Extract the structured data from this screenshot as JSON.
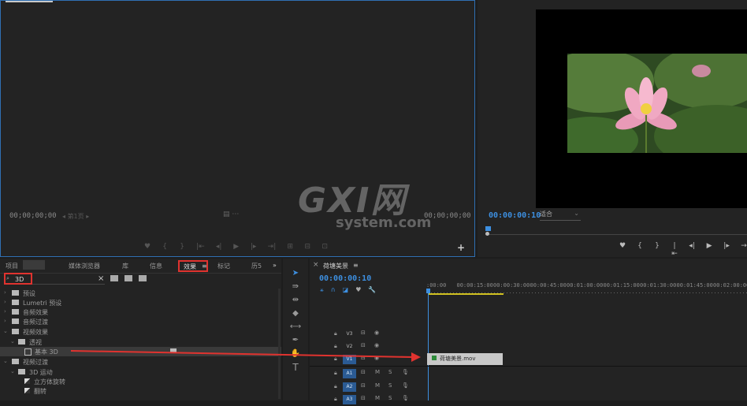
{
  "source_monitor": {
    "timecode_left": "00;00;00;00",
    "page_selector": "第1页",
    "timecode_right": "00;00;00;00",
    "controls": [
      "♥",
      "{",
      "}",
      "|⇤",
      "◂|",
      "▶",
      "|▸",
      "⇥|",
      "⊞",
      "⊟",
      "⊡"
    ],
    "add_button": "+"
  },
  "program_monitor": {
    "timecode": "00:00:00:10",
    "fit_label": "适合",
    "controls": [
      "♥",
      "{",
      "}",
      "|⇤",
      "◂|",
      "▶",
      "|▸",
      "→"
    ]
  },
  "watermark": {
    "brand": "GXI网",
    "domain": "system.com"
  },
  "effects_panel": {
    "tabs": [
      {
        "label": "项目"
      },
      {
        "label": "媒体浏览器"
      },
      {
        "label": "库"
      },
      {
        "label": "信息"
      },
      {
        "label": "效果"
      },
      {
        "label": "标记"
      },
      {
        "label": "历5"
      }
    ],
    "active_tab_menu": "≡",
    "overflow": "»",
    "search_value": "3D",
    "search_clear": "×",
    "tree": [
      {
        "label": "预设"
      },
      {
        "label": "Lumetri 预设"
      },
      {
        "label": "音频效果"
      },
      {
        "label": "音频过渡"
      },
      {
        "label": "视频效果"
      },
      {
        "label": "透视"
      },
      {
        "label": "基本 3D"
      },
      {
        "label": "视频过渡"
      },
      {
        "label": "3D 运动"
      },
      {
        "label": "立方体旋转"
      },
      {
        "label": "翻转"
      }
    ]
  },
  "timeline": {
    "sequence_name": "荷塘美景",
    "menu": "≡",
    "close": "×",
    "timecode": "00:00:00:10",
    "ruler": [
      ":00:00",
      "00:00:15:00",
      "00:00:30:00",
      "00:00:45:00",
      "00:01:00:00",
      "00:01:15:00",
      "00:01:30:00",
      "00:01:45:00",
      "00:02:00:00"
    ],
    "tracks": [
      {
        "name": "V3",
        "active": false
      },
      {
        "name": "V2",
        "active": false
      },
      {
        "name": "V1",
        "active": true
      },
      {
        "name": "A1",
        "active": true
      },
      {
        "name": "A2",
        "active": true
      },
      {
        "name": "A3",
        "active": true
      }
    ],
    "clip_name": "荷塘美景.mov"
  },
  "colors": {
    "accent_blue": "#3d8fe0",
    "highlight_red": "#e0332f",
    "track_blue": "#2b5b94"
  }
}
